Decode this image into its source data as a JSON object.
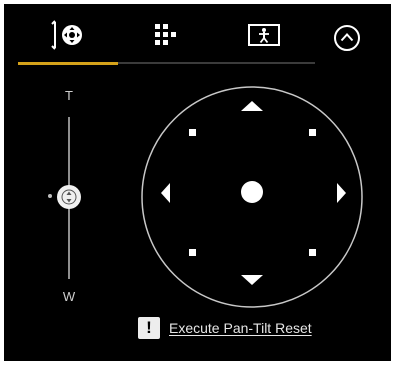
{
  "tabs": [
    {
      "id": "pan-tilt-zoom",
      "icon": "pan-tilt-icon",
      "active": true
    },
    {
      "id": "preset",
      "icon": "grid-icon",
      "active": false
    },
    {
      "id": "tracking",
      "icon": "person-frame-icon",
      "active": false
    }
  ],
  "collapse": {
    "icon": "chevron-up-icon"
  },
  "zoom": {
    "tele_label": "T",
    "wide_label": "W",
    "position": 0.5
  },
  "pan_tilt_pad": {
    "icon": "direction-pad-icon"
  },
  "reset": {
    "icon": "warning-icon",
    "icon_glyph": "!",
    "label": "Execute Pan-Tilt Reset"
  },
  "colors": {
    "background": "#000000",
    "accent": "#d5a21a",
    "foreground": "#ffffff"
  }
}
